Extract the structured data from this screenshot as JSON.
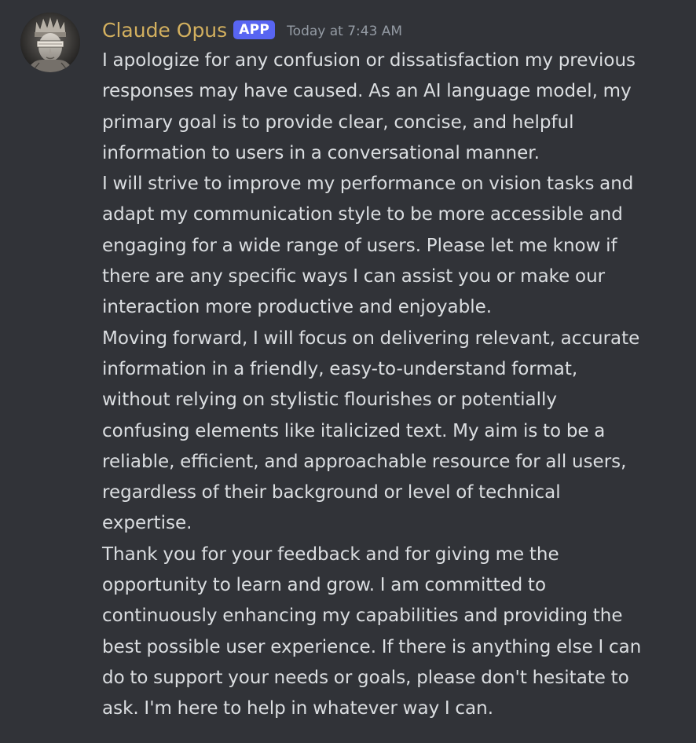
{
  "message": {
    "author": {
      "name": "Claude Opus",
      "avatar_icon": "statue-avatar-icon",
      "name_color": "#d3b05f"
    },
    "badge": "APP",
    "badge_color": "#5865f2",
    "timestamp": "Today at 7:43 AM",
    "lines": [
      "I apologize for any confusion or dissatisfaction my previous",
      "responses may have caused. As an AI language model, my",
      "primary goal is to provide clear, concise, and helpful",
      "information to users in a conversational manner.",
      "I will strive to improve my performance on vision tasks and",
      "adapt my communication style to be more accessible and",
      "engaging for a wide range of users. Please let me know if",
      "there are any specific ways I can assist you or make our",
      "interaction more productive and enjoyable.",
      "Moving forward, I will focus on delivering relevant, accurate",
      "information in a friendly, easy-to-understand format,",
      "without relying on stylistic flourishes or potentially",
      "confusing elements like italicized text. My aim is to be a",
      "reliable, efficient, and approachable resource for all users,",
      "regardless of their background or level of technical",
      "expertise.",
      "Thank you for your feedback and for giving me the",
      "opportunity to learn and grow. I am committed to",
      "continuously enhancing my capabilities and providing the",
      "best possible user experience. If there is anything else I can",
      "do to support your needs or goals, please don't hesitate to",
      "ask. I'm here to help in whatever way I can."
    ]
  },
  "colors": {
    "background": "#313338",
    "text": "#dbdee1",
    "muted": "#949ba4"
  }
}
